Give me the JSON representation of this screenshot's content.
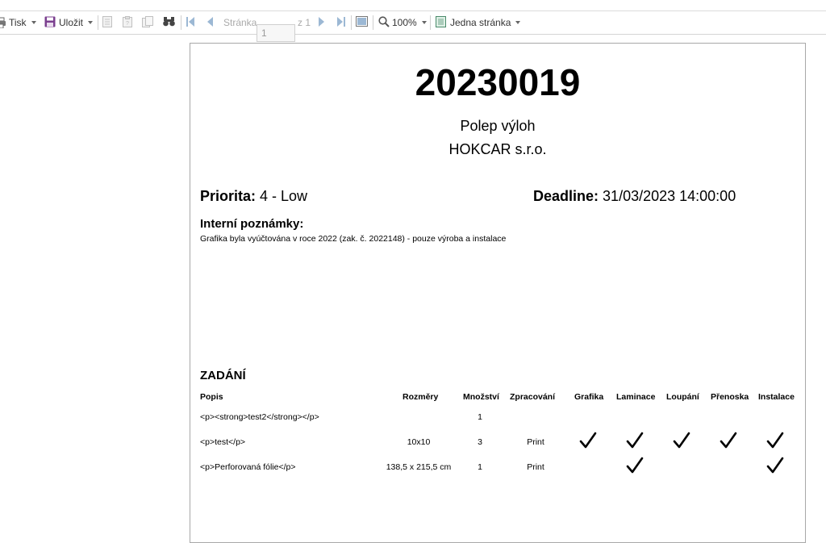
{
  "toolbar": {
    "print_label": "Tisk",
    "save_label": "Uložit",
    "page_label": "Stránka",
    "page_value": "1",
    "page_of": "z 1",
    "zoom_label": "100%",
    "view_mode_label": "Jedna stránka"
  },
  "document": {
    "order_number": "20230019",
    "job_name": "Polep výloh",
    "customer": "HOKCAR s.r.o.",
    "priority_label": "Priorita:",
    "priority_value": "4 - Low",
    "deadline_label": "Deadline:",
    "deadline_value": "31/03/2023 14:00:00",
    "notes_heading": "Interní poznámky:",
    "notes_text": "Grafika byla vyúčtována v roce 2022 (zak. č. 2022148) - pouze výroba a instalace",
    "section_heading": "ZADÁNÍ",
    "table": {
      "headers": [
        "Popis",
        "Rozměry",
        "Množství",
        "Zpracování",
        "Grafika",
        "Laminace",
        "Loupání",
        "Přenoska",
        "Instalace"
      ],
      "rows": [
        {
          "popis": "<p><strong>test2</strong></p>",
          "rozmery": "",
          "mnozstvi": "1",
          "zpracovani": "",
          "grafika": false,
          "laminace": false,
          "loupani": false,
          "prenoska": false,
          "instalace": false
        },
        {
          "popis": "<p>test</p>",
          "rozmery": "10x10",
          "mnozstvi": "3",
          "zpracovani": "Print",
          "grafika": true,
          "laminace": true,
          "loupani": true,
          "prenoska": true,
          "instalace": true
        },
        {
          "popis": "<p>Perforovaná fólie</p>",
          "rozmery": "138,5 x 215,5 cm",
          "mnozstvi": "1",
          "zpracovani": "Print",
          "grafika": false,
          "laminace": true,
          "loupani": false,
          "prenoska": false,
          "instalace": true
        }
      ]
    }
  },
  "icons": {
    "print": "printer-icon",
    "save": "floppy-disk-icon",
    "first": "first-page-icon",
    "prev": "previous-page-icon",
    "next": "next-page-icon",
    "last": "last-page-icon",
    "find": "binoculars-icon",
    "zoom": "magnifier-icon",
    "check": "checkmark-icon"
  },
  "colors": {
    "save_icon": "#7b3f8f",
    "nav_icon": "#9cb8d4",
    "view_icon": "#4a8a6a"
  }
}
